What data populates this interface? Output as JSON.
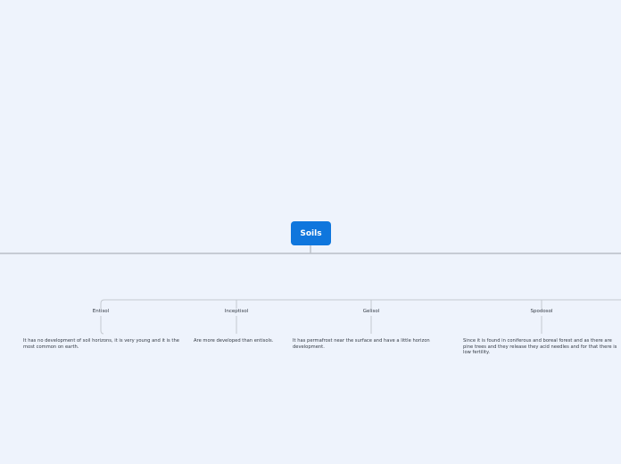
{
  "root": {
    "label": "Soils"
  },
  "topics": [
    {
      "id": "entisol",
      "label": "Entisol",
      "description": "It has no development of soil horizons, it is very young and it is the most common on earth."
    },
    {
      "id": "inceptisol",
      "label": "Inceptisol",
      "description": "Are more developed than entisols."
    },
    {
      "id": "gelisol",
      "label": "Gelisol",
      "description": "It has permafrost near the surface and have a little horizon development."
    },
    {
      "id": "spodosol",
      "label": "Spodosol",
      "description": "Since it is found in coniferous and boreal forest and as there are pine trees and they release they acid needles and for that there is low fertility."
    }
  ],
  "colors": {
    "background": "#eef3fc",
    "root_fill": "#0f76dd",
    "root_text": "#ffffff",
    "connector": "#b9bec6",
    "text": "#333a44"
  }
}
